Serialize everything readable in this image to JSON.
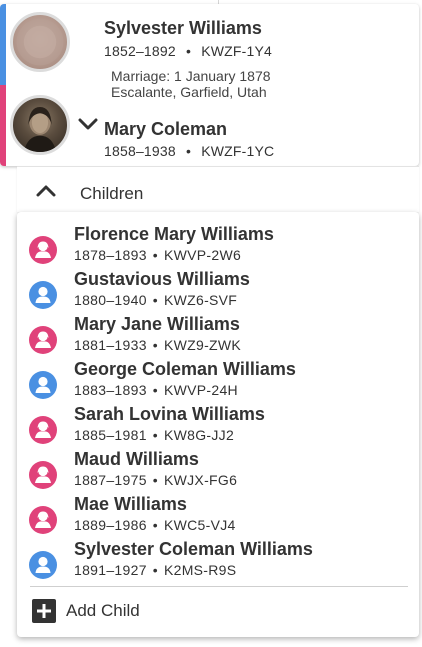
{
  "couple": {
    "husband": {
      "name": "Sylvester Williams",
      "years": "1852–1892",
      "pid": "KWZF-1Y4",
      "gender": "male"
    },
    "marriage": {
      "label": "Marriage: 1 January 1878",
      "place": "Escalante, Garfield, Utah"
    },
    "wife": {
      "name": "Mary Coleman",
      "years": "1858–1938",
      "pid": "KWZF-1YC",
      "gender": "female"
    }
  },
  "separator": "•",
  "children_section": {
    "label": "Children",
    "add_label": "Add Child"
  },
  "children": [
    {
      "name": "Florence Mary Williams",
      "years": "1878–1893",
      "pid": "KWVP-2W6",
      "gender": "female"
    },
    {
      "name": "Gustavious Williams",
      "years": "1880–1940",
      "pid": "KWZ6-SVF",
      "gender": "male"
    },
    {
      "name": "Mary Jane Williams",
      "years": "1881–1933",
      "pid": "KWZ9-ZWK",
      "gender": "female"
    },
    {
      "name": "George Coleman Williams",
      "years": "1883–1893",
      "pid": "KWVP-24H",
      "gender": "male"
    },
    {
      "name": "Sarah Lovina Williams",
      "years": "1885–1981",
      "pid": "KW8G-JJ2",
      "gender": "female"
    },
    {
      "name": "Maud Williams",
      "years": "1887–1975",
      "pid": "KWJX-FG6",
      "gender": "female"
    },
    {
      "name": "Mae Williams",
      "years": "1889–1986",
      "pid": "KWC5-VJ4",
      "gender": "female"
    },
    {
      "name": "Sylvester Coleman Williams",
      "years": "1891–1927",
      "pid": "K2MS-R9S",
      "gender": "male"
    }
  ],
  "colors": {
    "male": "#4a90e2",
    "female": "#e0427a",
    "text": "#333333"
  }
}
